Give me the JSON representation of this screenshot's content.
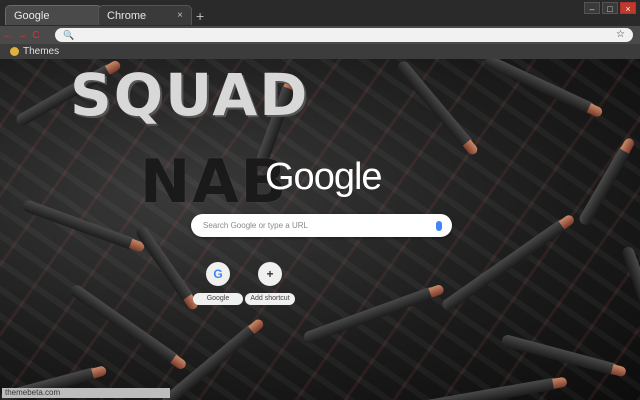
{
  "tabs": [
    {
      "label": "Google",
      "active": true
    },
    {
      "label": "Chrome",
      "active": false
    }
  ],
  "tab_close_glyph": "×",
  "new_tab_glyph": "+",
  "window_controls": {
    "minimize": "–",
    "maximize": "□",
    "close": "×"
  },
  "toolbar": {
    "back": "←",
    "forward": "→",
    "reload": "C",
    "search_glyph": "🔍",
    "star": "☆"
  },
  "bookmarks": [
    {
      "label": "Themes",
      "icon": "themes-icon"
    }
  ],
  "overlay": {
    "line1": "SQUAD",
    "line2": "NAB"
  },
  "google_logo": "Google",
  "search": {
    "placeholder": "Search Google or type a URL"
  },
  "shortcuts": [
    {
      "label": "Google",
      "glyph": "G",
      "icon": "google-icon"
    },
    {
      "label": "Add shortcut",
      "glyph": "+",
      "icon": "add-icon"
    }
  ],
  "status": "themebeta.com",
  "colors": {
    "accent_red": "#d33333",
    "google_blue": "#4285f4"
  }
}
